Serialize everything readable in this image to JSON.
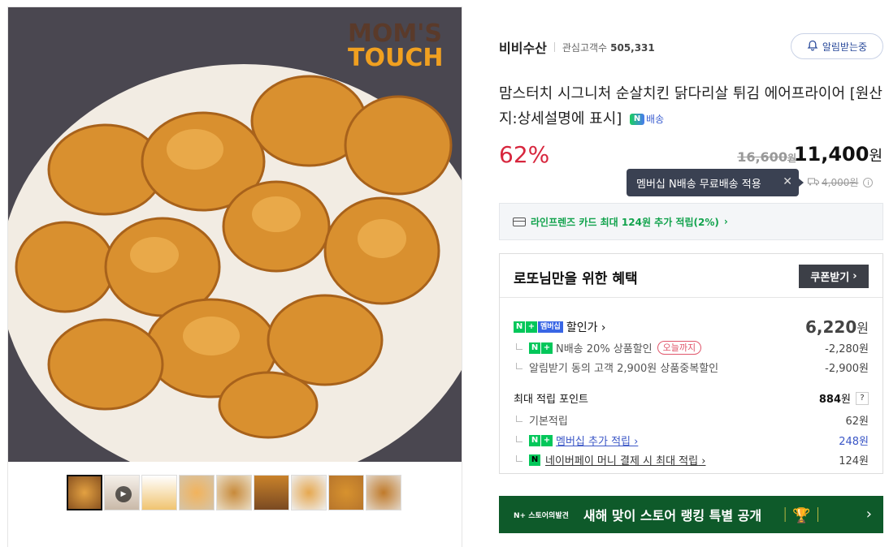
{
  "gallery": {
    "logo_line1": "MOM'S",
    "logo_line2": "TOUCH",
    "thumbnails": [
      "chicken-closeup",
      "video-person",
      "package",
      "eggs",
      "fried-plate",
      "burger",
      "fried-pieces",
      "nuggets",
      "sauce-bowl"
    ]
  },
  "store": {
    "name": "비비수산",
    "interest_label": "관심고객수",
    "interest_count": "505,331",
    "alarm_label": "알림받는중"
  },
  "product": {
    "title": "맘스터치 시그니처 순살치킨 닭다리살 튀김 에어프라이어 [원산지:상세설명에 표시]",
    "delivery_badge": "배송",
    "discount_rate": "62%",
    "original_price": "16,600",
    "original_unit": "원",
    "final_price": "11,400",
    "final_unit": "원"
  },
  "tooltip": {
    "text": "멤버십 N배송 무료배송 적용"
  },
  "shipping": {
    "fee": "4,000원"
  },
  "card": {
    "text": "라인프렌즈 카드 최대 124원 추가 적립(2%)"
  },
  "benefit": {
    "title": "로또님만을 위한 혜택",
    "coupon_label": "쿠폰받기",
    "member_price_label": "할인가",
    "membership_tag": "멤버십",
    "member_price": "6,220",
    "member_price_unit": "원",
    "discounts": [
      {
        "label": "N배송 20% 상품할인",
        "badge": "오늘까지",
        "value": "-2,280원"
      },
      {
        "label": "알림받기 동의 고객 2,900원 상품중복할인",
        "value": "-2,900원"
      }
    ],
    "points_label": "최대 적립 포인트",
    "points_value": "884",
    "points_unit": "원",
    "points": [
      {
        "label": "기본적립",
        "value": "62원"
      },
      {
        "label": "멤버십 추가 적립",
        "value": "248원"
      },
      {
        "label": "네이버페이 머니 결제 시 최대 적립",
        "value": "124원"
      }
    ]
  },
  "banner": {
    "tag": "N+ 스토어의발견",
    "text": "새해 맞이 스토어 랭킹 특별 공개"
  },
  "colors": {
    "discount": "#d7263d",
    "member_price": "#e3132e",
    "naver_green": "#03c75a",
    "banner_bg": "#0e5a2a"
  }
}
